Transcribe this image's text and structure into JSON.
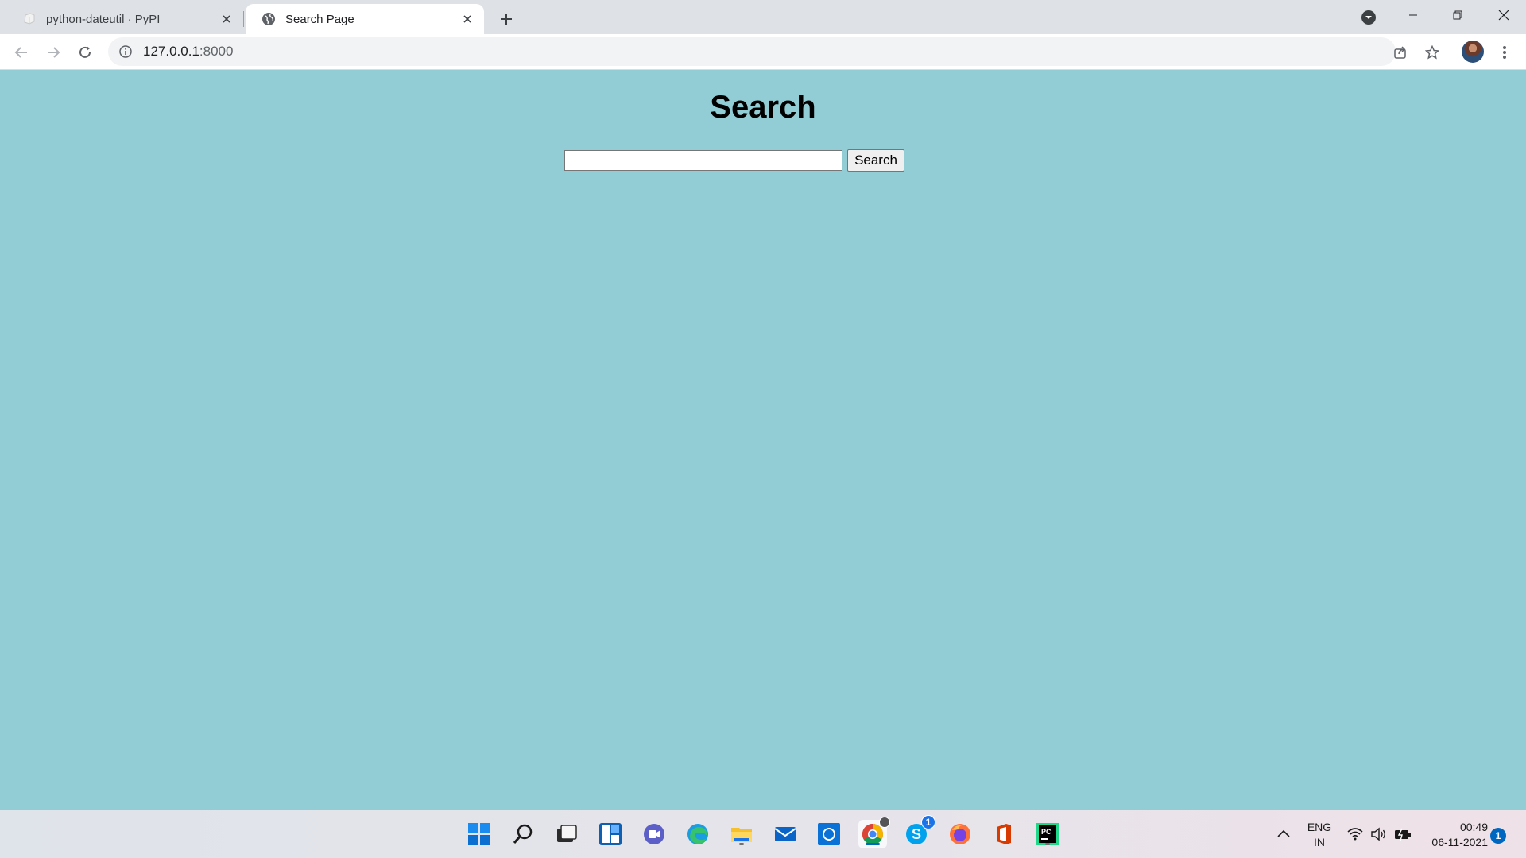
{
  "browser": {
    "tabs": [
      {
        "title": "python-dateutil · PyPI",
        "active": false
      },
      {
        "title": "Search Page",
        "active": true
      }
    ],
    "address": {
      "host": "127.0.0.1",
      "port": ":8000"
    }
  },
  "page": {
    "heading": "Search",
    "search": {
      "value": "",
      "placeholder": "",
      "button_label": "Search"
    },
    "background": "#92cdd5"
  },
  "taskbar": {
    "apps": [
      "start",
      "search",
      "task-view",
      "widgets",
      "teams-chat",
      "edge",
      "file-explorer",
      "mail",
      "dell-app",
      "chrome",
      "skype",
      "firefox",
      "office",
      "pycharm"
    ],
    "skype_badge": "1",
    "tray": {
      "lang_top": "ENG",
      "lang_bottom": "IN",
      "time": "00:49",
      "date": "06-11-2021",
      "notifications": "1"
    }
  }
}
